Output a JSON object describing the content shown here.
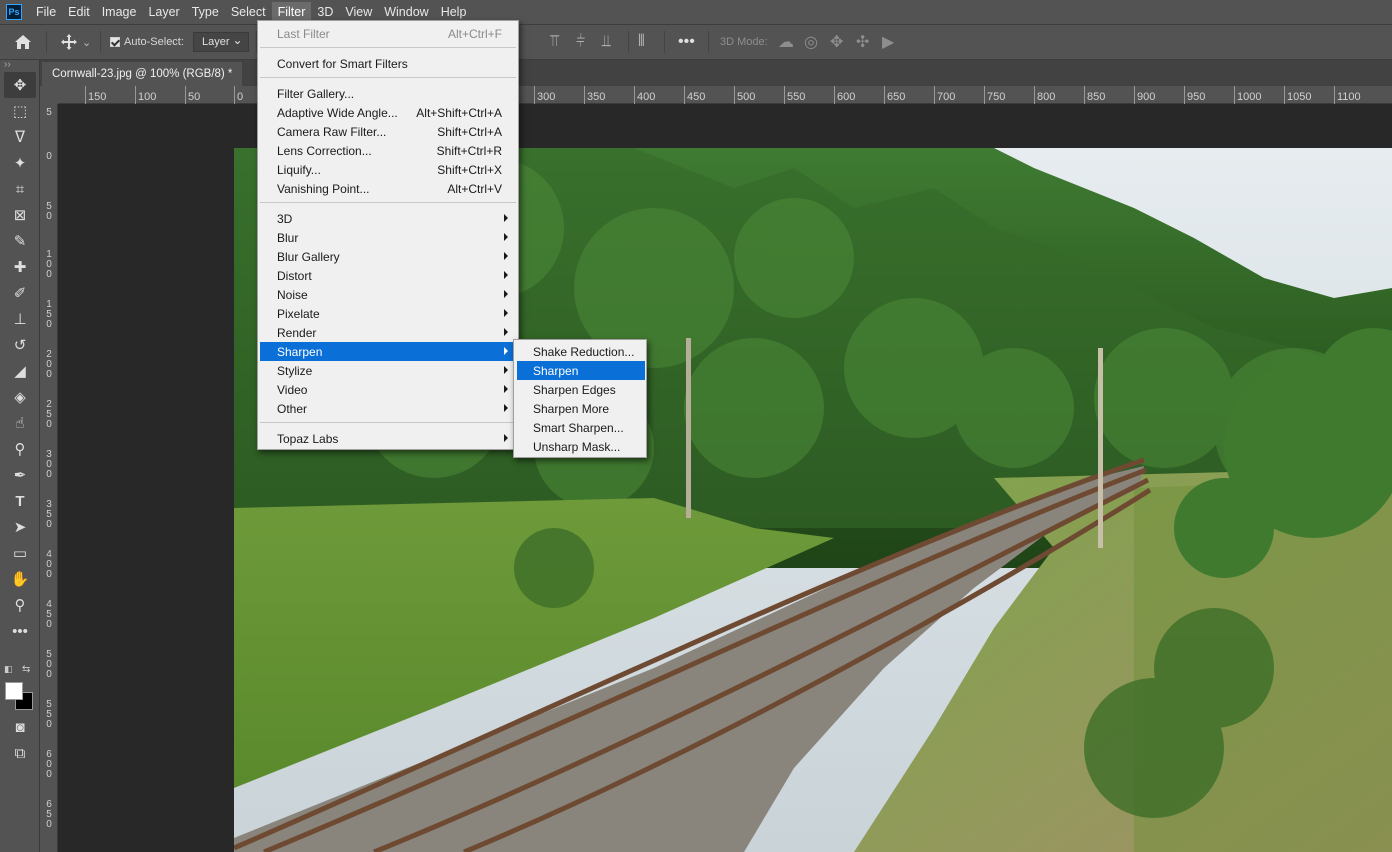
{
  "menubar": {
    "logo": "Ps",
    "items": [
      "File",
      "Edit",
      "Image",
      "Layer",
      "Type",
      "Select",
      "Filter",
      "3D",
      "View",
      "Window",
      "Help"
    ]
  },
  "options": {
    "auto_select_label": "Auto-Select:",
    "layer_select": "Layer",
    "mode_label": "3D Mode:"
  },
  "document": {
    "tab_title": "Cornwall-23.jpg @ 100% (RGB/8) *"
  },
  "ruler": {
    "h_labels": [
      "150",
      "100",
      "50",
      "0",
      "300",
      "350",
      "400",
      "450",
      "500",
      "550",
      "600",
      "650",
      "700",
      "750",
      "800",
      "850",
      "900",
      "950",
      "1000",
      "1050",
      "1100"
    ],
    "v_labels": [
      "5",
      "0",
      "5",
      "0",
      "1\n0\n0",
      "1\n5\n0",
      "2\n0\n0",
      "2\n5\n0",
      "3\n0\n0",
      "3\n5\n0",
      "4\n0\n0",
      "4\n5\n0",
      "5\n0\n0",
      "5\n5\n0",
      "6\n0\n0",
      "6\n5\n0"
    ]
  },
  "filter_menu": {
    "last_filter": "Last Filter",
    "last_filter_shortcut": "Alt+Ctrl+F",
    "convert_smart": "Convert for Smart Filters",
    "filter_gallery": "Filter Gallery...",
    "adaptive_wide": "Adaptive Wide Angle...",
    "adaptive_wide_shortcut": "Alt+Shift+Ctrl+A",
    "camera_raw": "Camera Raw Filter...",
    "camera_raw_shortcut": "Shift+Ctrl+A",
    "lens_correction": "Lens Correction...",
    "lens_correction_shortcut": "Shift+Ctrl+R",
    "liquify": "Liquify...",
    "liquify_shortcut": "Shift+Ctrl+X",
    "vanishing_point": "Vanishing Point...",
    "vanishing_point_shortcut": "Alt+Ctrl+V",
    "submenus": [
      "3D",
      "Blur",
      "Blur Gallery",
      "Distort",
      "Noise",
      "Pixelate",
      "Render",
      "Sharpen",
      "Stylize",
      "Video",
      "Other"
    ],
    "topaz": "Topaz Labs"
  },
  "sharpen_submenu": {
    "items": [
      "Shake Reduction...",
      "Sharpen",
      "Sharpen Edges",
      "Sharpen More",
      "Smart Sharpen...",
      "Unsharp Mask..."
    ]
  }
}
